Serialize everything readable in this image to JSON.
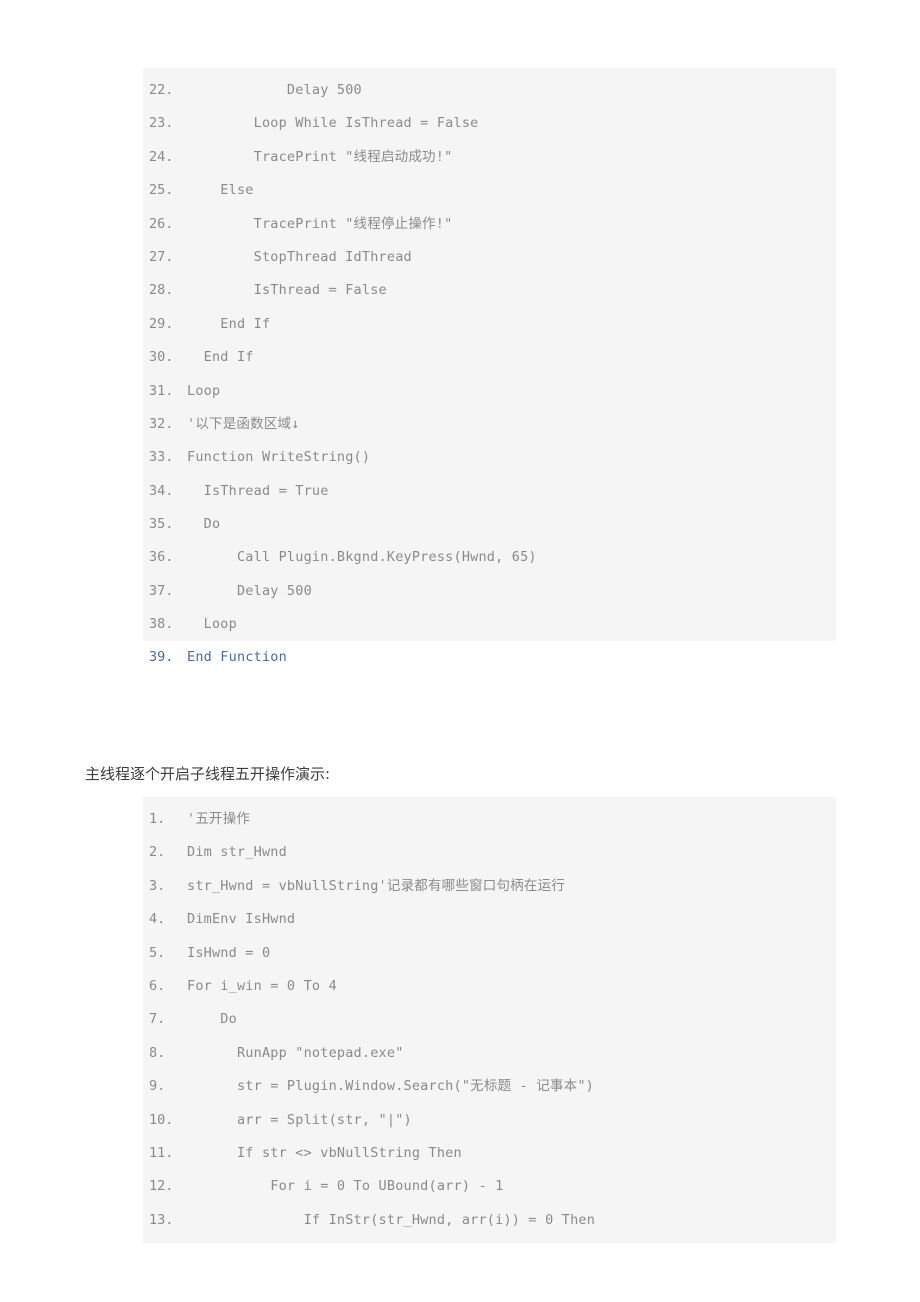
{
  "colors": {
    "page_background": "#ffffff",
    "code_background": "#f5f5f5",
    "code_text": "#8a8a8a",
    "highlight_text": "#4a6d9c",
    "heading_text": "#3d3d3d"
  },
  "code_block_one": {
    "name": "vbs-thread-code-listing-continued",
    "lines": [
      {
        "num": "22.",
        "text": "            Delay 500"
      },
      {
        "num": "23.",
        "text": "        Loop While IsThread = False"
      },
      {
        "num": "24.",
        "text": "        TracePrint \"线程启动成功!\""
      },
      {
        "num": "25.",
        "text": "    Else"
      },
      {
        "num": "26.",
        "text": "        TracePrint \"线程停止操作!\""
      },
      {
        "num": "27.",
        "text": "        StopThread IdThread"
      },
      {
        "num": "28.",
        "text": "        IsThread = False"
      },
      {
        "num": "29.",
        "text": "    End If"
      },
      {
        "num": "30.",
        "text": "  End If"
      },
      {
        "num": "31.",
        "text": "Loop"
      },
      {
        "num": "32.",
        "text": "'以下是函数区域↓"
      },
      {
        "num": "33.",
        "text": "Function WriteString()"
      },
      {
        "num": "34.",
        "text": "  IsThread = True"
      },
      {
        "num": "35.",
        "text": "  Do"
      },
      {
        "num": "36.",
        "text": "      Call Plugin.Bkgnd.KeyPress(Hwnd, 65)"
      },
      {
        "num": "37.",
        "text": "      Delay 500"
      },
      {
        "num": "38.",
        "text": "  Loop"
      }
    ]
  },
  "code_block_one_tail": {
    "name": "end-function-line",
    "lines": [
      {
        "num": "39.",
        "text": "End Function"
      }
    ]
  },
  "section_heading": {
    "text": "主线程逐个开启子线程五开操作演示:"
  },
  "code_block_two": {
    "name": "vbs-five-instance-code-listing",
    "lines": [
      {
        "num": "1.",
        "text": "'五开操作"
      },
      {
        "num": "2.",
        "text": "Dim str_Hwnd"
      },
      {
        "num": "3.",
        "text": "str_Hwnd = vbNullString'记录都有哪些窗口句柄在运行"
      },
      {
        "num": "4.",
        "text": "DimEnv IsHwnd"
      },
      {
        "num": "5.",
        "text": "IsHwnd = 0"
      },
      {
        "num": "6.",
        "text": "For i_win = 0 To 4"
      },
      {
        "num": "7.",
        "text": "    Do"
      },
      {
        "num": "8.",
        "text": "      RunApp \"notepad.exe\""
      },
      {
        "num": "9.",
        "text": "      str = Plugin.Window.Search(\"无标题 - 记事本\")"
      },
      {
        "num": "10.",
        "text": "      arr = Split(str, \"|\")"
      },
      {
        "num": "11.",
        "text": "      If str <> vbNullString Then"
      },
      {
        "num": "12.",
        "text": "          For i = 0 To UBound(arr) - 1"
      },
      {
        "num": "13.",
        "text": "              If InStr(str_Hwnd, arr(i)) = 0 Then"
      }
    ]
  }
}
